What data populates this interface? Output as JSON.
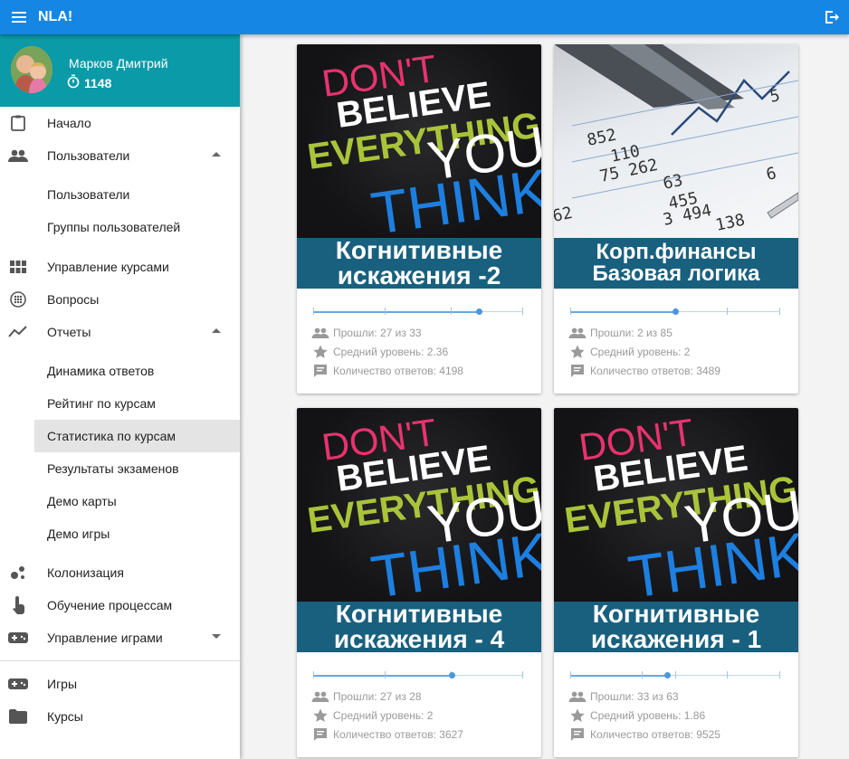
{
  "app": {
    "title": "NLA!"
  },
  "profile": {
    "name": "Марков Дмитрий",
    "coins": "1148"
  },
  "nav": {
    "home": "Начало",
    "users": "Пользователи",
    "users_sub": [
      "Пользователи",
      "Группы пользователей"
    ],
    "courses_mgmt": "Управление курсами",
    "questions": "Вопросы",
    "reports": "Отчеты",
    "reports_sub": [
      "Динамика ответов",
      "Рейтинг по курсам",
      "Статистика по курсам",
      "Результаты экзаменов",
      "Демо карты",
      "Демо игры"
    ],
    "colonization": "Колонизация",
    "process_training": "Обучение процессам",
    "games_mgmt": "Управление играми",
    "games": "Игры",
    "courses": "Курсы"
  },
  "poster": {
    "line1": "DON'T",
    "line2": "BELIEVE",
    "line3": "EVERYTHING",
    "line4": "YOU",
    "line5": "THINK."
  },
  "cards": [
    {
      "title_l1": "Когнитивные",
      "title_l2": "искажения -2",
      "image": "dont-believe-poster",
      "passed": "Прошли: 27 из 33",
      "avg": "Средний уровень: 2.36",
      "answers": "Количество ответов: 4198",
      "level_fraction": 0.79
    },
    {
      "title_l1": "Корп.финансы",
      "title_l2": "Базовая логика",
      "image": "financial-report-photo",
      "passed": "Прошли: 2 из 85",
      "avg": "Средний уровень: 2",
      "answers": "Количество ответов: 3489",
      "level_fraction": 0.5,
      "finance_numbers": [
        "852",
        "110",
        "75 262",
        "63",
        "455",
        "62",
        "3 494",
        "138",
        "5",
        "6"
      ]
    },
    {
      "title_l1": "Когнитивные",
      "title_l2": "искажения - 4",
      "image": "dont-believe-poster",
      "passed": "Прошли: 27 из 28",
      "avg": "Средний уровень: 2",
      "answers": "Количество ответов: 3627",
      "level_fraction": 0.66
    },
    {
      "title_l1": "Когнитивные",
      "title_l2": "искажения - 1",
      "image": "dont-believe-poster",
      "passed": "Прошли: 33 из 63",
      "avg": "Средний уровень: 1.86",
      "answers": "Количество ответов: 9525",
      "level_fraction": 0.46
    }
  ],
  "colors": {
    "appbar": "#1686e4",
    "profile": "#0a9aa8",
    "banner": "#19607f",
    "slider": "#4b97dc"
  }
}
